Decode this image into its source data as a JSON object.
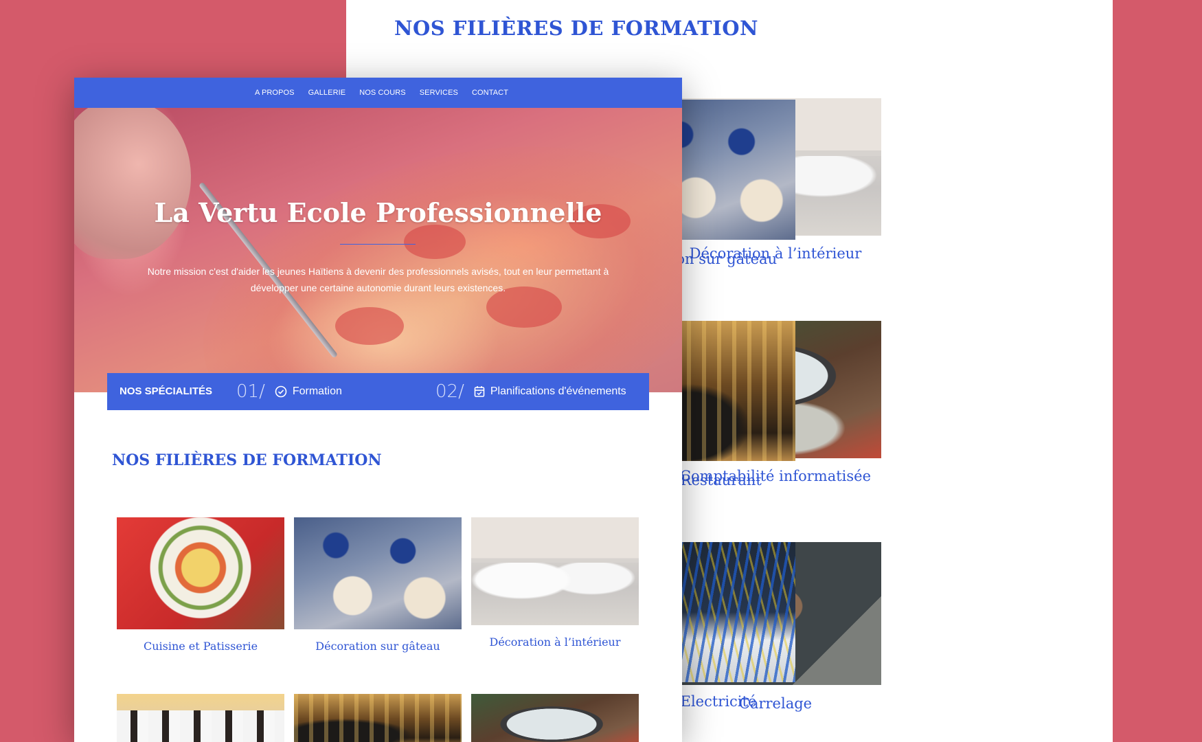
{
  "back_page": {
    "section_title": "NOS FILIÈRES DE FORMATION",
    "cards": [
      {
        "caption": "oration sur gâteau",
        "image_icon": "cupcakes-photo"
      },
      {
        "caption": "Décoration à l’intérieur",
        "image_icon": "living-room-photo"
      },
      {
        "caption": "ar et Restaurant",
        "image_icon": "bar-photo"
      },
      {
        "caption": "Comptabilité informatisée",
        "image_icon": "laptop-calculator-photo"
      },
      {
        "caption": "Electricité",
        "image_icon": "electrical-panel-photo"
      },
      {
        "caption": "Carrelage",
        "image_icon": "tile-cutting-photo"
      }
    ]
  },
  "front_page": {
    "nav": [
      "A PROPOS",
      "GALLERIE",
      "NOS COURS",
      "SERVICES",
      "CONTACT"
    ],
    "hero": {
      "title": "La Vertu Ecole Professionnelle",
      "mission": "Notre mission c'est d'aider les jeunes Haïtiens à devenir des professionnels avisés, tout en leur permettant à développer une certaine autonomie durant leurs existences.",
      "image_icon": "pizza-fork-photo"
    },
    "specialties": {
      "label": "NOS SPÉCIALITÉS",
      "items": [
        {
          "number": "01/",
          "icon": "check-circle-icon",
          "label": "Formation"
        },
        {
          "number": "02/",
          "icon": "calendar-check-icon",
          "label": "Planifications d'événements"
        }
      ]
    },
    "section_title": "NOS FILIÈRES DE FORMATION",
    "cards": [
      {
        "caption": "Cuisine et Patisserie",
        "image_icon": "food-platter-photo"
      },
      {
        "caption": "Décoration sur gâteau",
        "image_icon": "cupcakes-photo"
      },
      {
        "caption": "Décoration à l’intérieur",
        "image_icon": "living-room-photo"
      },
      {
        "caption": "",
        "image_icon": "chefs-group-photo"
      },
      {
        "caption": "",
        "image_icon": "bar-photo"
      },
      {
        "caption": "",
        "image_icon": "laptop-calculator-photo"
      }
    ]
  },
  "colors": {
    "background": "#d45a6a",
    "brand_blue": "#3f63de",
    "title_blue": "#2f55d4"
  }
}
